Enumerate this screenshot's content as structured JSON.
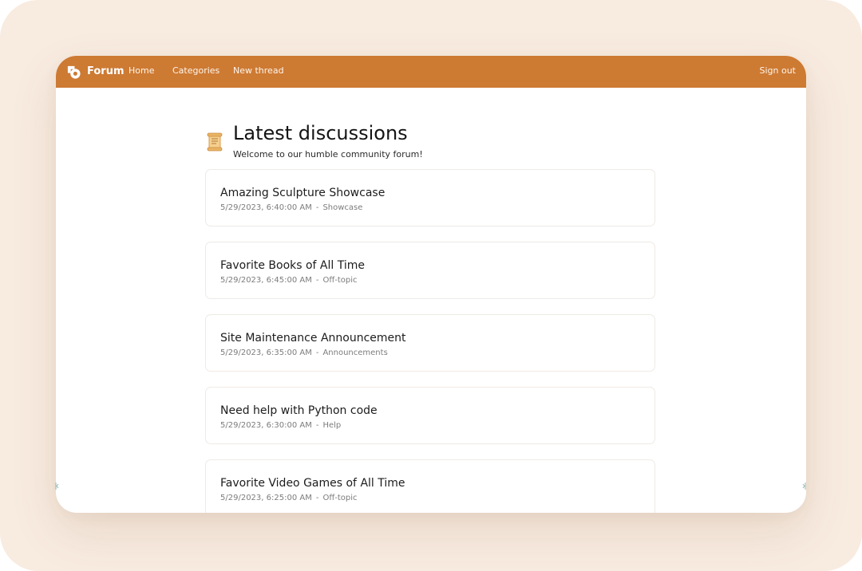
{
  "nav": {
    "brand": "Forum",
    "links": [
      {
        "label": "Home"
      },
      {
        "label": "Categories"
      },
      {
        "label": "New thread"
      }
    ],
    "sign_out": "Sign out"
  },
  "header": {
    "icon": "scroll-icon",
    "title": "Latest discussions",
    "subtitle": "Welcome to our humble community forum!"
  },
  "threads": [
    {
      "title": "Amazing Sculpture Showcase",
      "date": "5/29/2023, 6:40:00 AM",
      "category": "Showcase"
    },
    {
      "title": "Favorite Books of All Time",
      "date": "5/29/2023, 6:45:00 AM",
      "category": "Off-topic"
    },
    {
      "title": "Site Maintenance Announcement",
      "date": "5/29/2023, 6:35:00 AM",
      "category": "Announcements"
    },
    {
      "title": "Need help with Python code",
      "date": "5/29/2023, 6:30:00 AM",
      "category": "Help"
    },
    {
      "title": "Favorite Video Games of All Time",
      "date": "5/29/2023, 6:25:00 AM",
      "category": "Off-topic"
    }
  ],
  "meta_separator": "-",
  "colors": {
    "navbar": "#cd7a33",
    "backdrop": "#f8ebe0",
    "card_border": "#efeae6"
  }
}
